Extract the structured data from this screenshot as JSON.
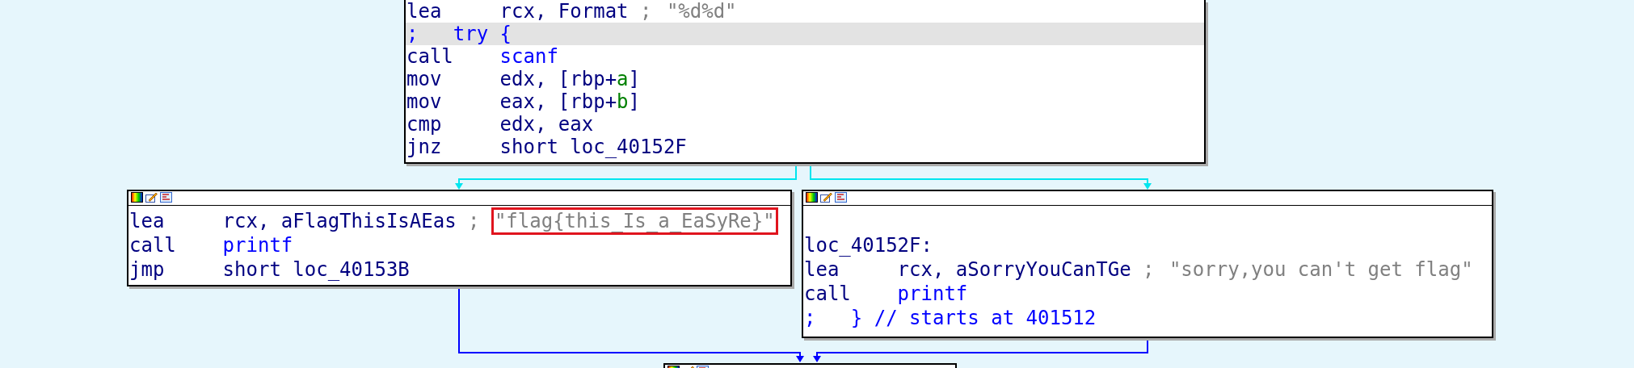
{
  "blocks": [
    {
      "header_icons": false,
      "lines": [
        {
          "kind": "code",
          "highlighted": false,
          "parts": [
            {
              "kind": "mnemonic",
              "text": "lea"
            },
            {
              "kind": "operand",
              "segments": [
                {
                  "kind": "plain",
                  "text": "rcx, Format"
                }
              ]
            },
            {
              "kind": "comment",
              "text": ";"
            },
            {
              "kind": "string",
              "boxed": false,
              "text": "\"%d%d\""
            }
          ]
        },
        {
          "kind": "code",
          "highlighted": true,
          "parts": [
            {
              "kind": "directive",
              "text": ";   try {"
            }
          ]
        },
        {
          "kind": "code",
          "highlighted": false,
          "parts": [
            {
              "kind": "mnemonic",
              "text": "call"
            },
            {
              "kind": "operand",
              "segments": [
                {
                  "kind": "function",
                  "text": "scanf"
                }
              ]
            }
          ]
        },
        {
          "kind": "code",
          "highlighted": false,
          "parts": [
            {
              "kind": "mnemonic",
              "text": "mov"
            },
            {
              "kind": "operand",
              "segments": [
                {
                  "kind": "plain",
                  "text": "edx, [rbp+"
                },
                {
                  "kind": "variable",
                  "text": "a"
                },
                {
                  "kind": "plain",
                  "text": "]"
                }
              ]
            }
          ]
        },
        {
          "kind": "code",
          "highlighted": false,
          "parts": [
            {
              "kind": "mnemonic",
              "text": "mov"
            },
            {
              "kind": "operand",
              "segments": [
                {
                  "kind": "plain",
                  "text": "eax, [rbp+"
                },
                {
                  "kind": "variable",
                  "text": "b"
                },
                {
                  "kind": "plain",
                  "text": "]"
                }
              ]
            }
          ]
        },
        {
          "kind": "code",
          "highlighted": false,
          "parts": [
            {
              "kind": "mnemonic",
              "text": "cmp"
            },
            {
              "kind": "operand",
              "segments": [
                {
                  "kind": "plain",
                  "text": "edx, eax"
                }
              ]
            }
          ]
        },
        {
          "kind": "code",
          "highlighted": false,
          "parts": [
            {
              "kind": "mnemonic",
              "text": "jnz"
            },
            {
              "kind": "operand",
              "segments": [
                {
                  "kind": "plain",
                  "text": "short loc_40152F"
                }
              ]
            }
          ]
        }
      ]
    },
    {
      "header_icons": true,
      "lines": [
        {
          "kind": "code",
          "highlighted": false,
          "parts": [
            {
              "kind": "mnemonic",
              "text": "lea"
            },
            {
              "kind": "operand",
              "segments": [
                {
                  "kind": "plain",
                  "text": "rcx, aFlagThisIsAEas"
                }
              ]
            },
            {
              "kind": "comment",
              "text": ";"
            },
            {
              "kind": "string",
              "boxed": true,
              "text": "\"flag{this_Is_a_EaSyRe}\""
            }
          ]
        },
        {
          "kind": "code",
          "highlighted": false,
          "parts": [
            {
              "kind": "mnemonic",
              "text": "call"
            },
            {
              "kind": "operand",
              "segments": [
                {
                  "kind": "function",
                  "text": "printf"
                }
              ]
            }
          ]
        },
        {
          "kind": "code",
          "highlighted": false,
          "parts": [
            {
              "kind": "mnemonic",
              "text": "jmp"
            },
            {
              "kind": "operand",
              "segments": [
                {
                  "kind": "plain",
                  "text": "short loc_40153B"
                }
              ]
            }
          ]
        }
      ]
    },
    {
      "header_icons": true,
      "lines": [
        {
          "kind": "blank",
          "highlighted": false
        },
        {
          "kind": "code",
          "highlighted": false,
          "parts": [
            {
              "kind": "label",
              "text": "loc_40152F:"
            }
          ]
        },
        {
          "kind": "code",
          "highlighted": false,
          "parts": [
            {
              "kind": "mnemonic",
              "text": "lea"
            },
            {
              "kind": "operand",
              "segments": [
                {
                  "kind": "plain",
                  "text": "rcx, aSorryYouCanTGe"
                }
              ]
            },
            {
              "kind": "comment",
              "text": ";"
            },
            {
              "kind": "string",
              "boxed": false,
              "text": "\"sorry,you can't get flag\""
            }
          ]
        },
        {
          "kind": "code",
          "highlighted": false,
          "parts": [
            {
              "kind": "mnemonic",
              "text": "call"
            },
            {
              "kind": "operand",
              "segments": [
                {
                  "kind": "function",
                  "text": "printf"
                }
              ]
            }
          ]
        },
        {
          "kind": "code",
          "highlighted": false,
          "parts": [
            {
              "kind": "directive",
              "text": ";   } // starts at 401512"
            }
          ]
        }
      ]
    },
    {
      "header_icons": true
    }
  ]
}
